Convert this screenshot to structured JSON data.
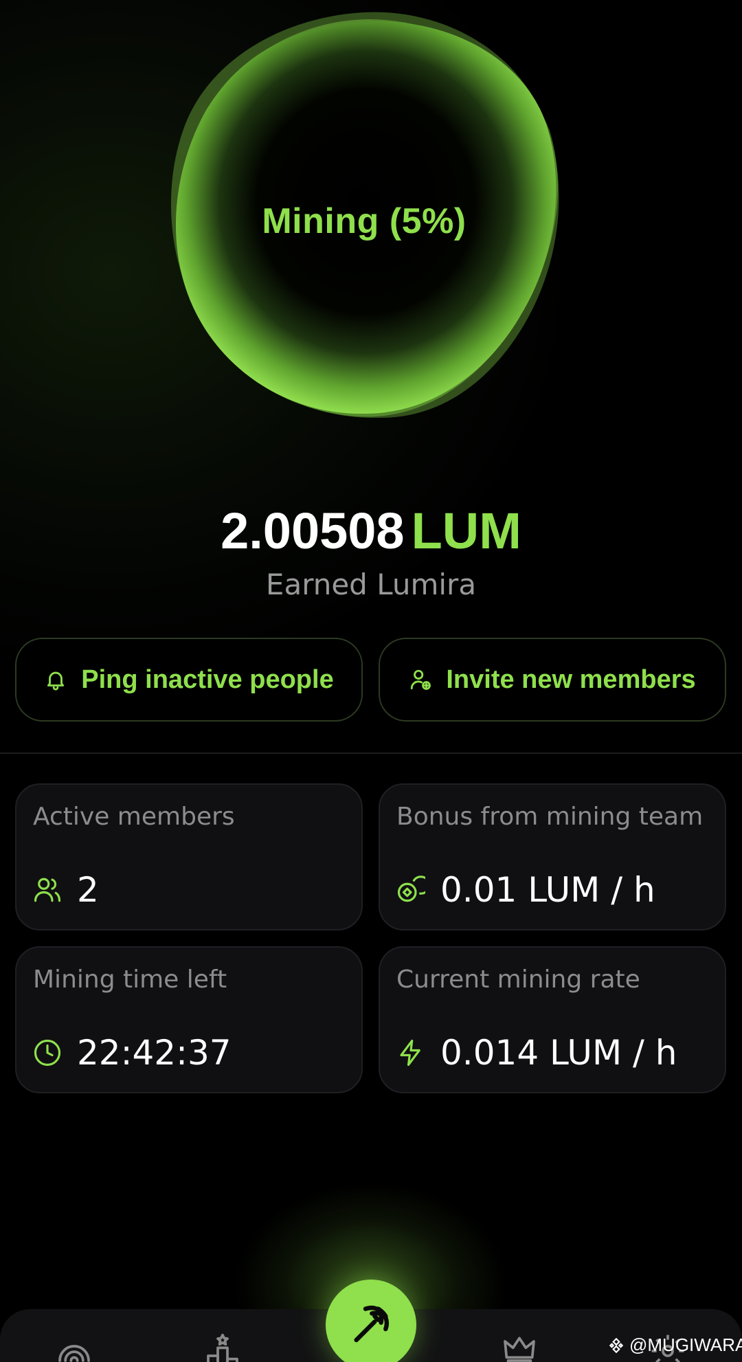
{
  "mining": {
    "label": "Mining",
    "percent_text": "(5%)",
    "progress_percent": 5
  },
  "balance": {
    "amount": "2.00508",
    "currency": "LUM",
    "caption": "Earned Lumira"
  },
  "actions": {
    "ping_label": "Ping inactive people",
    "invite_label": "Invite new members"
  },
  "stats": {
    "active_members": {
      "label": "Active members",
      "value": "2",
      "icon": "users-icon"
    },
    "bonus": {
      "label": "Bonus from mining team",
      "value": "0.01 LUM / h",
      "icon": "coins-icon"
    },
    "time_left": {
      "label": "Mining time left",
      "value": "22:42:37",
      "icon": "clock-icon"
    },
    "rate": {
      "label": "Current mining rate",
      "value": "0.014 LUM / h",
      "icon": "lightning-icon"
    }
  },
  "nav": {
    "items": [
      "radar-icon",
      "leaderboard-icon",
      "pickaxe-icon",
      "crown-icon",
      "settings-icon"
    ],
    "active": "pickaxe-icon"
  },
  "watermark": {
    "text": "@MUGIWARA"
  },
  "colors": {
    "accent": "#8fe04c",
    "background": "#000000",
    "card": "#101013",
    "muted_text": "#8c8c8c"
  }
}
